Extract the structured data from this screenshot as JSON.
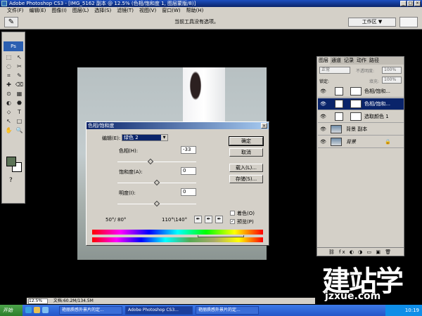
{
  "window": {
    "title": "Adobe Photoshop CS3 - [IMG_5162 副本 @ 12.5% (色相/饱和度 1, 图层蒙版/8)]",
    "controls": [
      "_",
      "□",
      "×"
    ]
  },
  "menu": [
    "文件(F)",
    "编辑(E)",
    "图像(I)",
    "图层(L)",
    "选择(S)",
    "滤镜(T)",
    "视图(V)",
    "窗口(W)",
    "帮助(H)"
  ],
  "options": {
    "message": "当前工具没有选项。",
    "workspace": "工作区 ▼"
  },
  "toolbox": {
    "ps": "Ps",
    "tools": [
      "⬚",
      "↖",
      "◌",
      "✂",
      "⌗",
      "✎",
      "✚",
      "⌫",
      "⊙",
      "▦",
      "◐",
      "⬣",
      "⬦",
      "T",
      "↖",
      "□",
      "✋",
      "🔍"
    ],
    "help": "?",
    "fg_color": "#5c7356",
    "bg_color": "#ffffff"
  },
  "dialog": {
    "title": "色相/饱和度",
    "edit_label": "编辑(E):",
    "edit_value": "绿色 2",
    "hue_label": "色相(H):",
    "hue_value": "-33",
    "sat_label": "饱和度(A):",
    "sat_value": "0",
    "light_label": "明度(I):",
    "light_value": "0",
    "buttons": {
      "ok": "确定",
      "cancel": "取消",
      "load": "载入(L)...",
      "save": "存储(S)..."
    },
    "colorize_label": "着色(O)",
    "preview_label": "预览(P)",
    "preview_checked": "✓",
    "range_left": "50°/ 80°",
    "range_right": "110°\\140°",
    "hue_position": 0.42,
    "sat_position": 0.5,
    "light_position": 0.5
  },
  "layers": {
    "tabs": [
      "图层",
      "通道",
      "记录",
      "动作",
      "路径"
    ],
    "blend": "正常",
    "opacity_label": "不透明度:",
    "opacity": "100%",
    "lock_label": "锁定:",
    "fill_label": "填充:",
    "fill": "100%",
    "items": [
      {
        "name": "色相/饱和..."
      },
      {
        "name": "色相/饱和..."
      },
      {
        "name": "选取颜色 1"
      },
      {
        "name": "背景 副本"
      },
      {
        "name": "背景"
      }
    ],
    "footer": "⛓ fx ◐ ◑ ▭ ▣ 🗑"
  },
  "status": {
    "zoom": "12.5%",
    "doc": "文档:60.2M/134.5M"
  },
  "taskbar": {
    "start": "开始",
    "tasks": [
      "艳丽质感外景片的定...",
      "Adobe Photoshop CS3...",
      "艳丽质感外景片的定..."
    ],
    "time": "10:19"
  },
  "watermark": {
    "main": "建站学",
    "sub": "jzxue.com"
  }
}
